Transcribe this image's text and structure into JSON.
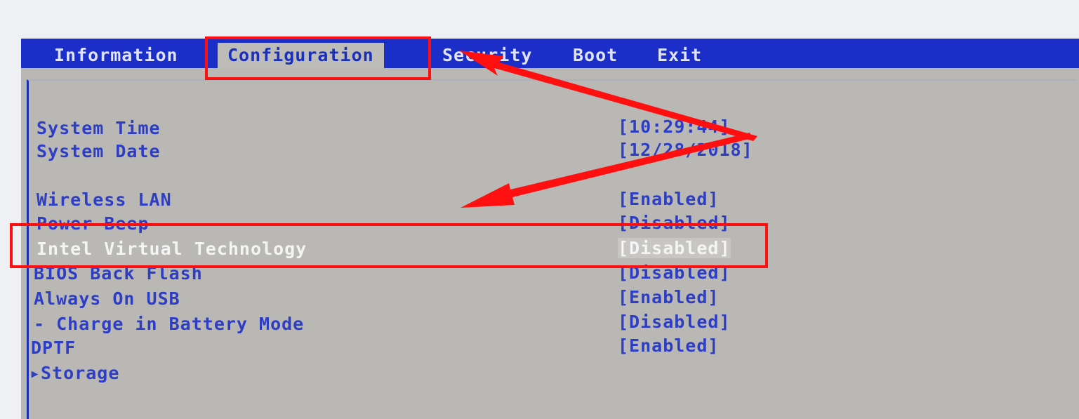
{
  "menu": {
    "tabs": [
      {
        "label": "Information"
      },
      {
        "label": "Configuration"
      },
      {
        "label": "Security"
      },
      {
        "label": "Boot"
      },
      {
        "label": "Exit"
      }
    ],
    "active_tab": "Configuration"
  },
  "settings": [
    {
      "label": "System Time",
      "value": "[10:29:44]"
    },
    {
      "label": "System Date",
      "value": "[12/28/2018]"
    },
    {
      "label": "Wireless LAN",
      "value": "[Enabled]"
    },
    {
      "label": "Power Beep",
      "value": "[Disabled]"
    },
    {
      "label": "Intel Virtual Technology",
      "value": "[Disabled]"
    },
    {
      "label": "BIOS Back Flash",
      "value": "[Disabled]"
    },
    {
      "label": "Always On USB",
      "value": "[Enabled]"
    },
    {
      "label": "- Charge in Battery Mode",
      "value": "[Disabled]"
    },
    {
      "label": "DPTF",
      "value": "[Enabled]"
    },
    {
      "label": "▸Storage"
    }
  ],
  "selected_setting": "Intel Virtual Technology",
  "colors": {
    "menubar": "#1b2fc8",
    "panel": "#b9b8b5",
    "text": "#2d3dc4",
    "highlight_text": "#f4f4f4",
    "annotation": "#ff1010"
  }
}
